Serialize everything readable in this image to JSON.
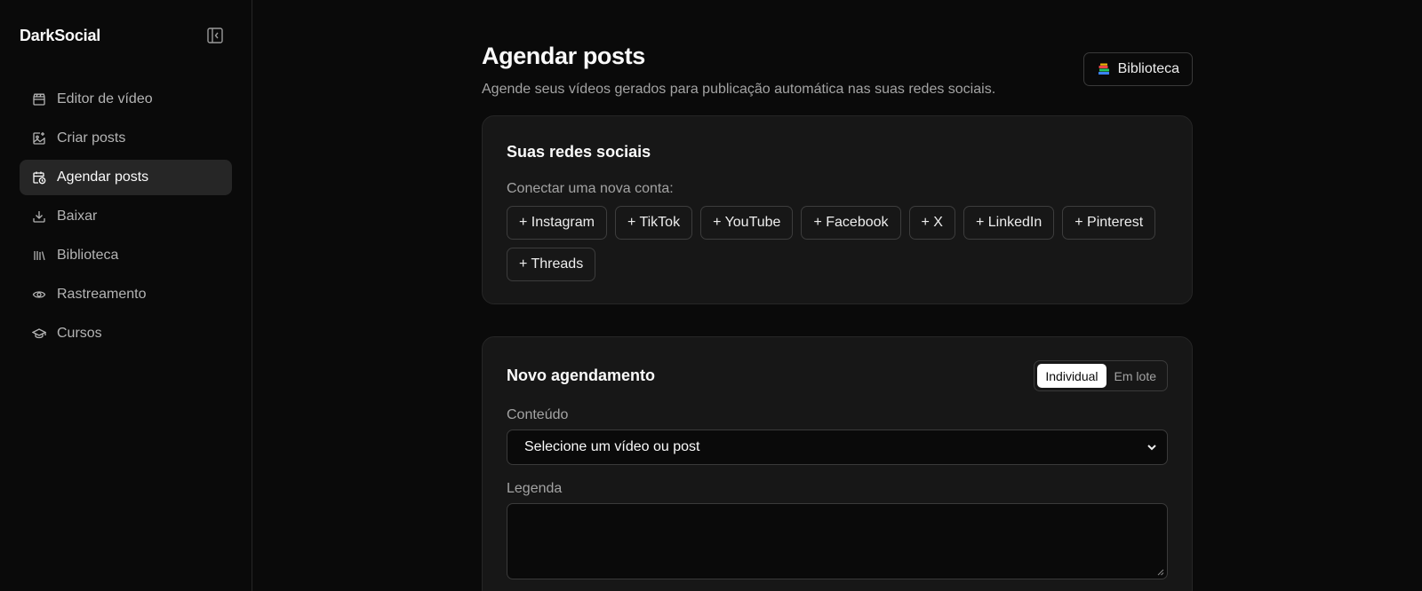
{
  "sidebar": {
    "brand": "DarkSocial",
    "items": [
      {
        "label": "Editor de vídeo",
        "icon": "clapperboard-icon"
      },
      {
        "label": "Criar posts",
        "icon": "image-plus-icon"
      },
      {
        "label": "Agendar posts",
        "icon": "calendar-clock-icon",
        "active": true
      },
      {
        "label": "Baixar",
        "icon": "download-icon"
      },
      {
        "label": "Biblioteca",
        "icon": "library-icon"
      },
      {
        "label": "Rastreamento",
        "icon": "eye-icon"
      },
      {
        "label": "Cursos",
        "icon": "graduation-cap-icon"
      }
    ]
  },
  "page": {
    "title": "Agendar posts",
    "subtitle": "Agende seus vídeos gerados para publicação automática nas suas redes sociais.",
    "library_button": "Biblioteca"
  },
  "social": {
    "title": "Suas redes sociais",
    "connect_label": "Conectar uma nova conta:",
    "networks": [
      "+ Instagram",
      "+ TikTok",
      "+ YouTube",
      "+ Facebook",
      "+ X",
      "+ LinkedIn",
      "+ Pinterest",
      "+ Threads"
    ]
  },
  "schedule": {
    "title": "Novo agendamento",
    "toggle": {
      "individual": "Individual",
      "batch": "Em lote",
      "selected": "Individual"
    },
    "content_label": "Conteúdo",
    "content_select": "Selecione um vídeo ou post",
    "caption_label": "Legenda",
    "caption_value": ""
  },
  "colors": {
    "background": "#0a0a0a",
    "card": "#171717",
    "border": "#262626",
    "active_nav": "#262626"
  }
}
